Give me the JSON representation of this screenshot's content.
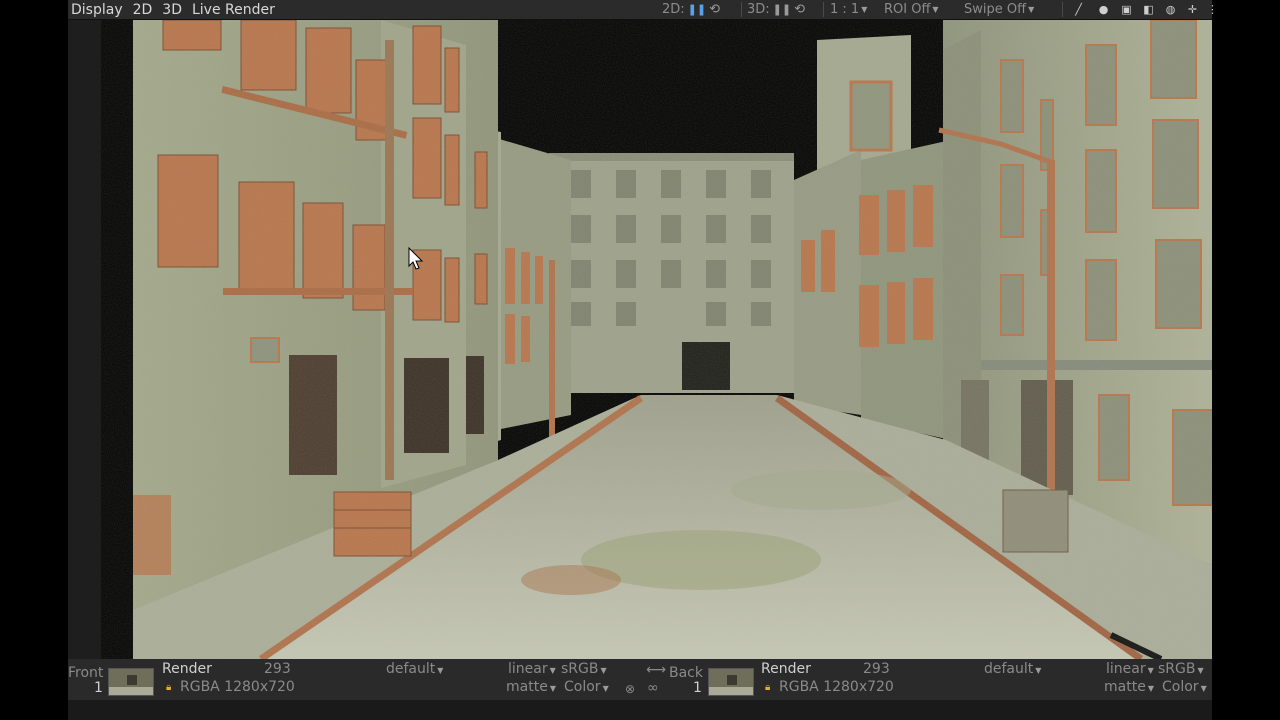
{
  "menu": {
    "items": [
      "Display",
      "2D",
      "3D",
      "Live Render"
    ]
  },
  "toolbar": {
    "label_2d": "2D:",
    "label_3d": "3D:",
    "ratio": "1 : 1",
    "roi": "ROI Off",
    "swipe": "Swipe Off"
  },
  "bottom": {
    "left": {
      "view_label": "Front",
      "view_index": "1",
      "name": "Render",
      "frame": "293",
      "format": "RGBA 1280x720",
      "preset": "default",
      "colorspace_in": "linear",
      "colorspace_out": "sRGB",
      "alpha_mode": "matte",
      "channel": "Color"
    },
    "right": {
      "view_label": "Back",
      "view_index": "1",
      "name": "Render",
      "frame": "293",
      "format": "RGBA 1280x720",
      "preset": "default",
      "colorspace_in": "linear",
      "colorspace_out": "sRGB",
      "alpha_mode": "matte",
      "channel": "Color"
    }
  },
  "colors": {
    "accent": "#5aa0e6",
    "lock": "#e0b030",
    "panel": "#2a2a2a",
    "brick": "#b8744a",
    "wall": "#a9ad8e"
  },
  "icons": [
    "pause-icon",
    "refresh-icon",
    "brush-icon",
    "chat-icon",
    "layers-icon",
    "expand-icon",
    "globe-icon",
    "crosshair-icon",
    "swap-icon",
    "link-icon"
  ]
}
